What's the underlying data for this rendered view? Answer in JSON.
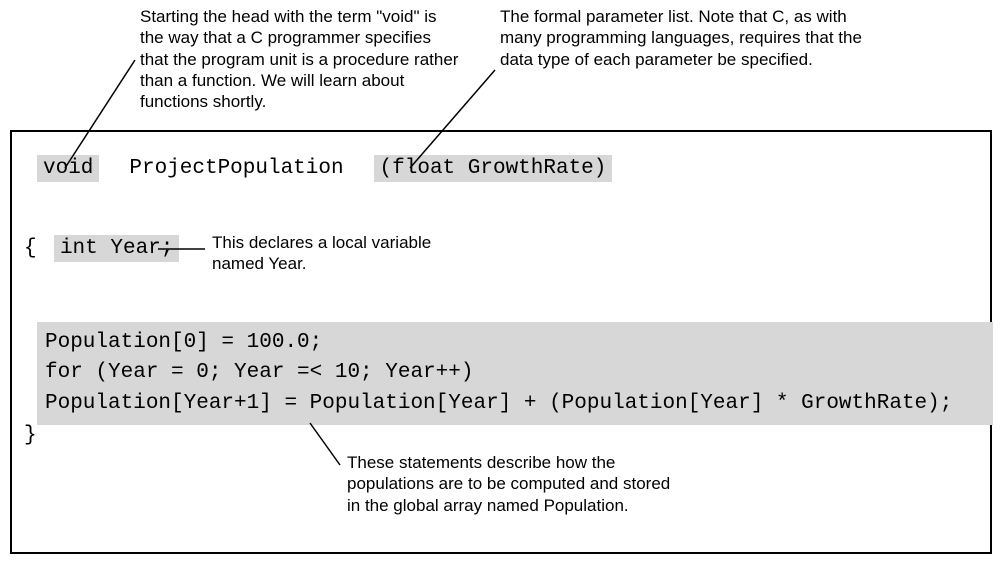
{
  "annotations": {
    "void_note": "Starting the head with the term \"void\" is the way that a C programmer specifies that the program unit is a procedure rather than a function. We will learn about functions shortly.",
    "param_note": "The formal parameter list. Note that C, as with many programming languages, requires that the data type of each parameter be specified.",
    "year_note": "This declares a local variable named Year.",
    "body_note": "These statements describe how the populations are to be computed and stored in the global array named Population."
  },
  "code": {
    "void_kw": "void",
    "fn_name": "  ProjectPopulation  ",
    "param_list": "(float GrowthRate)",
    "open_brace": "{ ",
    "int_year": "int Year;",
    "body_line1": "Population[0] = 100.0;",
    "body_line2": "for (Year = 0; Year =< 10; Year++)",
    "body_line3": "Population[Year+1] = Population[Year] + (Population[Year] * GrowthRate);",
    "close_brace": "}"
  }
}
